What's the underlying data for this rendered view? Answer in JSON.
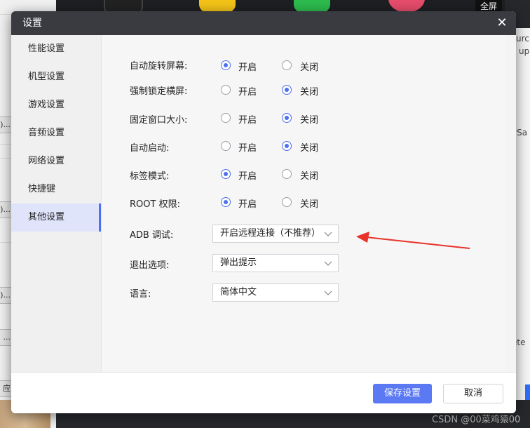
{
  "background": {
    "fullscreen_label": "全屏",
    "right_fragments": [
      "urc",
      "up",
      "ySa",
      "ete"
    ],
    "left_fragments": [
      ")...",
      ")...",
      ")...",
      "...",
      "应"
    ]
  },
  "watermark": "CSDN @00菜鸡猿00",
  "dialog": {
    "title": "设置",
    "close_glyph": "✕",
    "sidebar": [
      {
        "label": "性能设置",
        "active": false
      },
      {
        "label": "机型设置",
        "active": false
      },
      {
        "label": "游戏设置",
        "active": false
      },
      {
        "label": "音频设置",
        "active": false
      },
      {
        "label": "网络设置",
        "active": false
      },
      {
        "label": "快捷键",
        "active": false
      },
      {
        "label": "其他设置",
        "active": true
      }
    ],
    "radio_options": {
      "on": "开启",
      "off": "关闭"
    },
    "radio_rows": [
      {
        "label": "自动旋转屏幕:",
        "selected": "on"
      },
      {
        "label": "强制锁定横屏:",
        "selected": "off"
      },
      {
        "label": "固定窗口大小:",
        "selected": "off"
      },
      {
        "label": "自动启动:",
        "selected": "off"
      },
      {
        "label": "标签模式:",
        "selected": "on"
      },
      {
        "label": "ROOT 权限:",
        "selected": "on"
      }
    ],
    "select_rows": [
      {
        "label": "ADB 调试:",
        "value": "开启远程连接（不推荐）"
      },
      {
        "label": "退出选项:",
        "value": "弹出提示"
      },
      {
        "label": "语言:",
        "value": "简体中文"
      }
    ],
    "footer": {
      "save_label": "保存设置",
      "cancel_label": "取消"
    }
  },
  "colors": {
    "accent": "#4d70f1",
    "primary_button": "#5b79f3",
    "titlebar": "#393b40",
    "annotation_arrow": "#e8332a"
  }
}
